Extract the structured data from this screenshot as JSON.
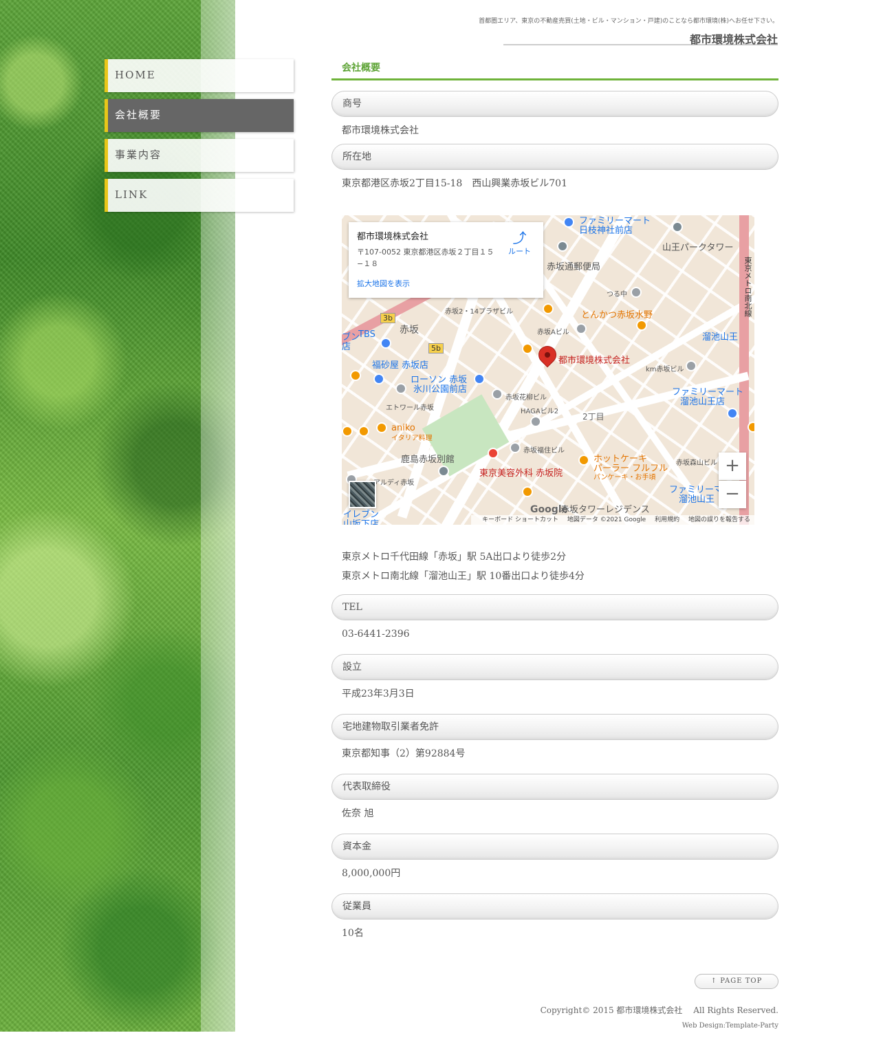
{
  "header": {
    "tagline": "首都圏エリア、東京の不動産売買(土地・ビル・マンション・戸建)のことなら都市環境(株)へお任せ下さい。",
    "logo": "都市環境株式会社"
  },
  "nav": {
    "items": [
      {
        "label": "HOME",
        "active": false
      },
      {
        "label": "会社概要",
        "active": true
      },
      {
        "label": "事業内容",
        "active": false
      },
      {
        "label": "LINK",
        "active": false
      }
    ]
  },
  "main": {
    "title": "会社概要",
    "rows": [
      {
        "head": "商号",
        "value": "都市環境株式会社"
      },
      {
        "head": "所在地",
        "value": "東京都港区赤坂2丁目15-18　西山興業赤坂ビル701"
      },
      {
        "head": "TEL",
        "value": "03-6441-2396"
      },
      {
        "head": "設立",
        "value": "平成23年3月3日"
      },
      {
        "head": "宅地建物取引業者免許",
        "value": "東京都知事（2）第92884号"
      },
      {
        "head": "代表取締役",
        "value": "佐奈 旭"
      },
      {
        "head": "資本金",
        "value": "8,000,000円"
      },
      {
        "head": "従業員",
        "value": "10名"
      }
    ],
    "access": [
      "東京メトロ千代田線「赤坂」駅 5A出口より徒歩2分",
      "東京メトロ南北線「溜池山王」駅 10番出口より徒歩4分"
    ]
  },
  "map": {
    "card_title": "都市環境株式会社",
    "card_address": "〒107-0052 東京都港区赤坂２丁目１５−１８",
    "card_link": "拡大地図を表示",
    "route_label": "ルート",
    "pin_label": "都市環境株式会社",
    "labels": {
      "familymart_hie": "ファミリーマート",
      "familymart_hie2": "日枝神社前店",
      "sanno_park": "山王パークタワー",
      "akasaka_post": "赤坂通郵便局",
      "tsuruchu": "つる中",
      "tonkatsu": "とんかつ赤坂水野",
      "akasaka_a_bldg": "赤坂Aビル",
      "akasaka214": "赤坂2・14プラザビル",
      "akasaka_station": "赤坂",
      "tameike": "溜池山王",
      "exit3b": "3b",
      "exit5b": "5b",
      "tbs": "TBS",
      "fukusaya": "福砂屋 赤坂店",
      "lawson": "ローソン 赤坂",
      "lawson2": "氷川公園前店",
      "km_bldg": "km赤坂ビル",
      "familymart_tameike": "ファミリーマート",
      "familymart_tameike2": "溜池山王店",
      "etoile": "エトワール赤坂",
      "hanayagi": "赤坂花柳ビル",
      "haga": "HAGAビル2",
      "nichome": "2丁目",
      "aniko": "aniko",
      "aniko2": "イタリア料理",
      "kajima": "鹿島赤坂別館",
      "fukuju": "赤坂福住ビル",
      "clinic": "東京美容外科 赤坂院",
      "hotcake": "ホットケーキ",
      "hotcake2": "パーラー フルフル",
      "hotcake3": "パンケーキ・お手頃",
      "moriyama": "赤坂森山ビル",
      "familymart3": "ファミリーマ",
      "familymart3b": "溜池山王",
      "tower_res": "赤坂タワーレジデンス",
      "namboku": "東京メトロ南北線",
      "ardy": "アルディ赤坂",
      "eleven": "イレブン",
      "eleven2": "山坂下店",
      "partial_left": "ブン",
      "partial_left2": "店",
      "google": "Google"
    },
    "footer": {
      "keyboard": "キーボード ショートカット",
      "data": "地図データ ©2021 Google",
      "terms": "利用規約",
      "report": "地図の誤りを報告する"
    },
    "zoom_in": "+",
    "zoom_out": "−"
  },
  "footer": {
    "pagetop": "↑ PAGE TOP",
    "copyright": "Copyright© 2015 都市環境株式会社　 All Rights Reserved.",
    "webdesign": "Web Design:Template-Party"
  },
  "colors": {
    "accent_green": "#6fb33a",
    "nav_border": "#e8c619",
    "nav_active": "#666666",
    "map_pin": "#d93025",
    "poi_orange": "#f29900",
    "poi_blue": "#4285f4"
  }
}
